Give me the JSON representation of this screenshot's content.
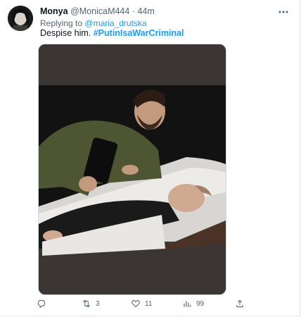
{
  "tweet": {
    "display_name": "Monya",
    "handle": "@MonicaM444",
    "separator": "·",
    "time": "44m",
    "replying_prefix": "Replying to",
    "replying_to": "@maria_drutska",
    "text": "Despise him.",
    "hashtag": "#PutinIsaWarCriminal"
  },
  "actions": {
    "replies": "",
    "retweets": "3",
    "likes": "11",
    "views": "99"
  },
  "icons": {
    "more": "more-dots-icon",
    "reply": "reply-icon",
    "retweet": "retweet-icon",
    "like": "heart-icon",
    "views": "analytics-icon",
    "share": "share-icon"
  },
  "colors": {
    "link": "#1d9bf0",
    "secondary_text": "#536471",
    "media_background": "#3b3634"
  }
}
